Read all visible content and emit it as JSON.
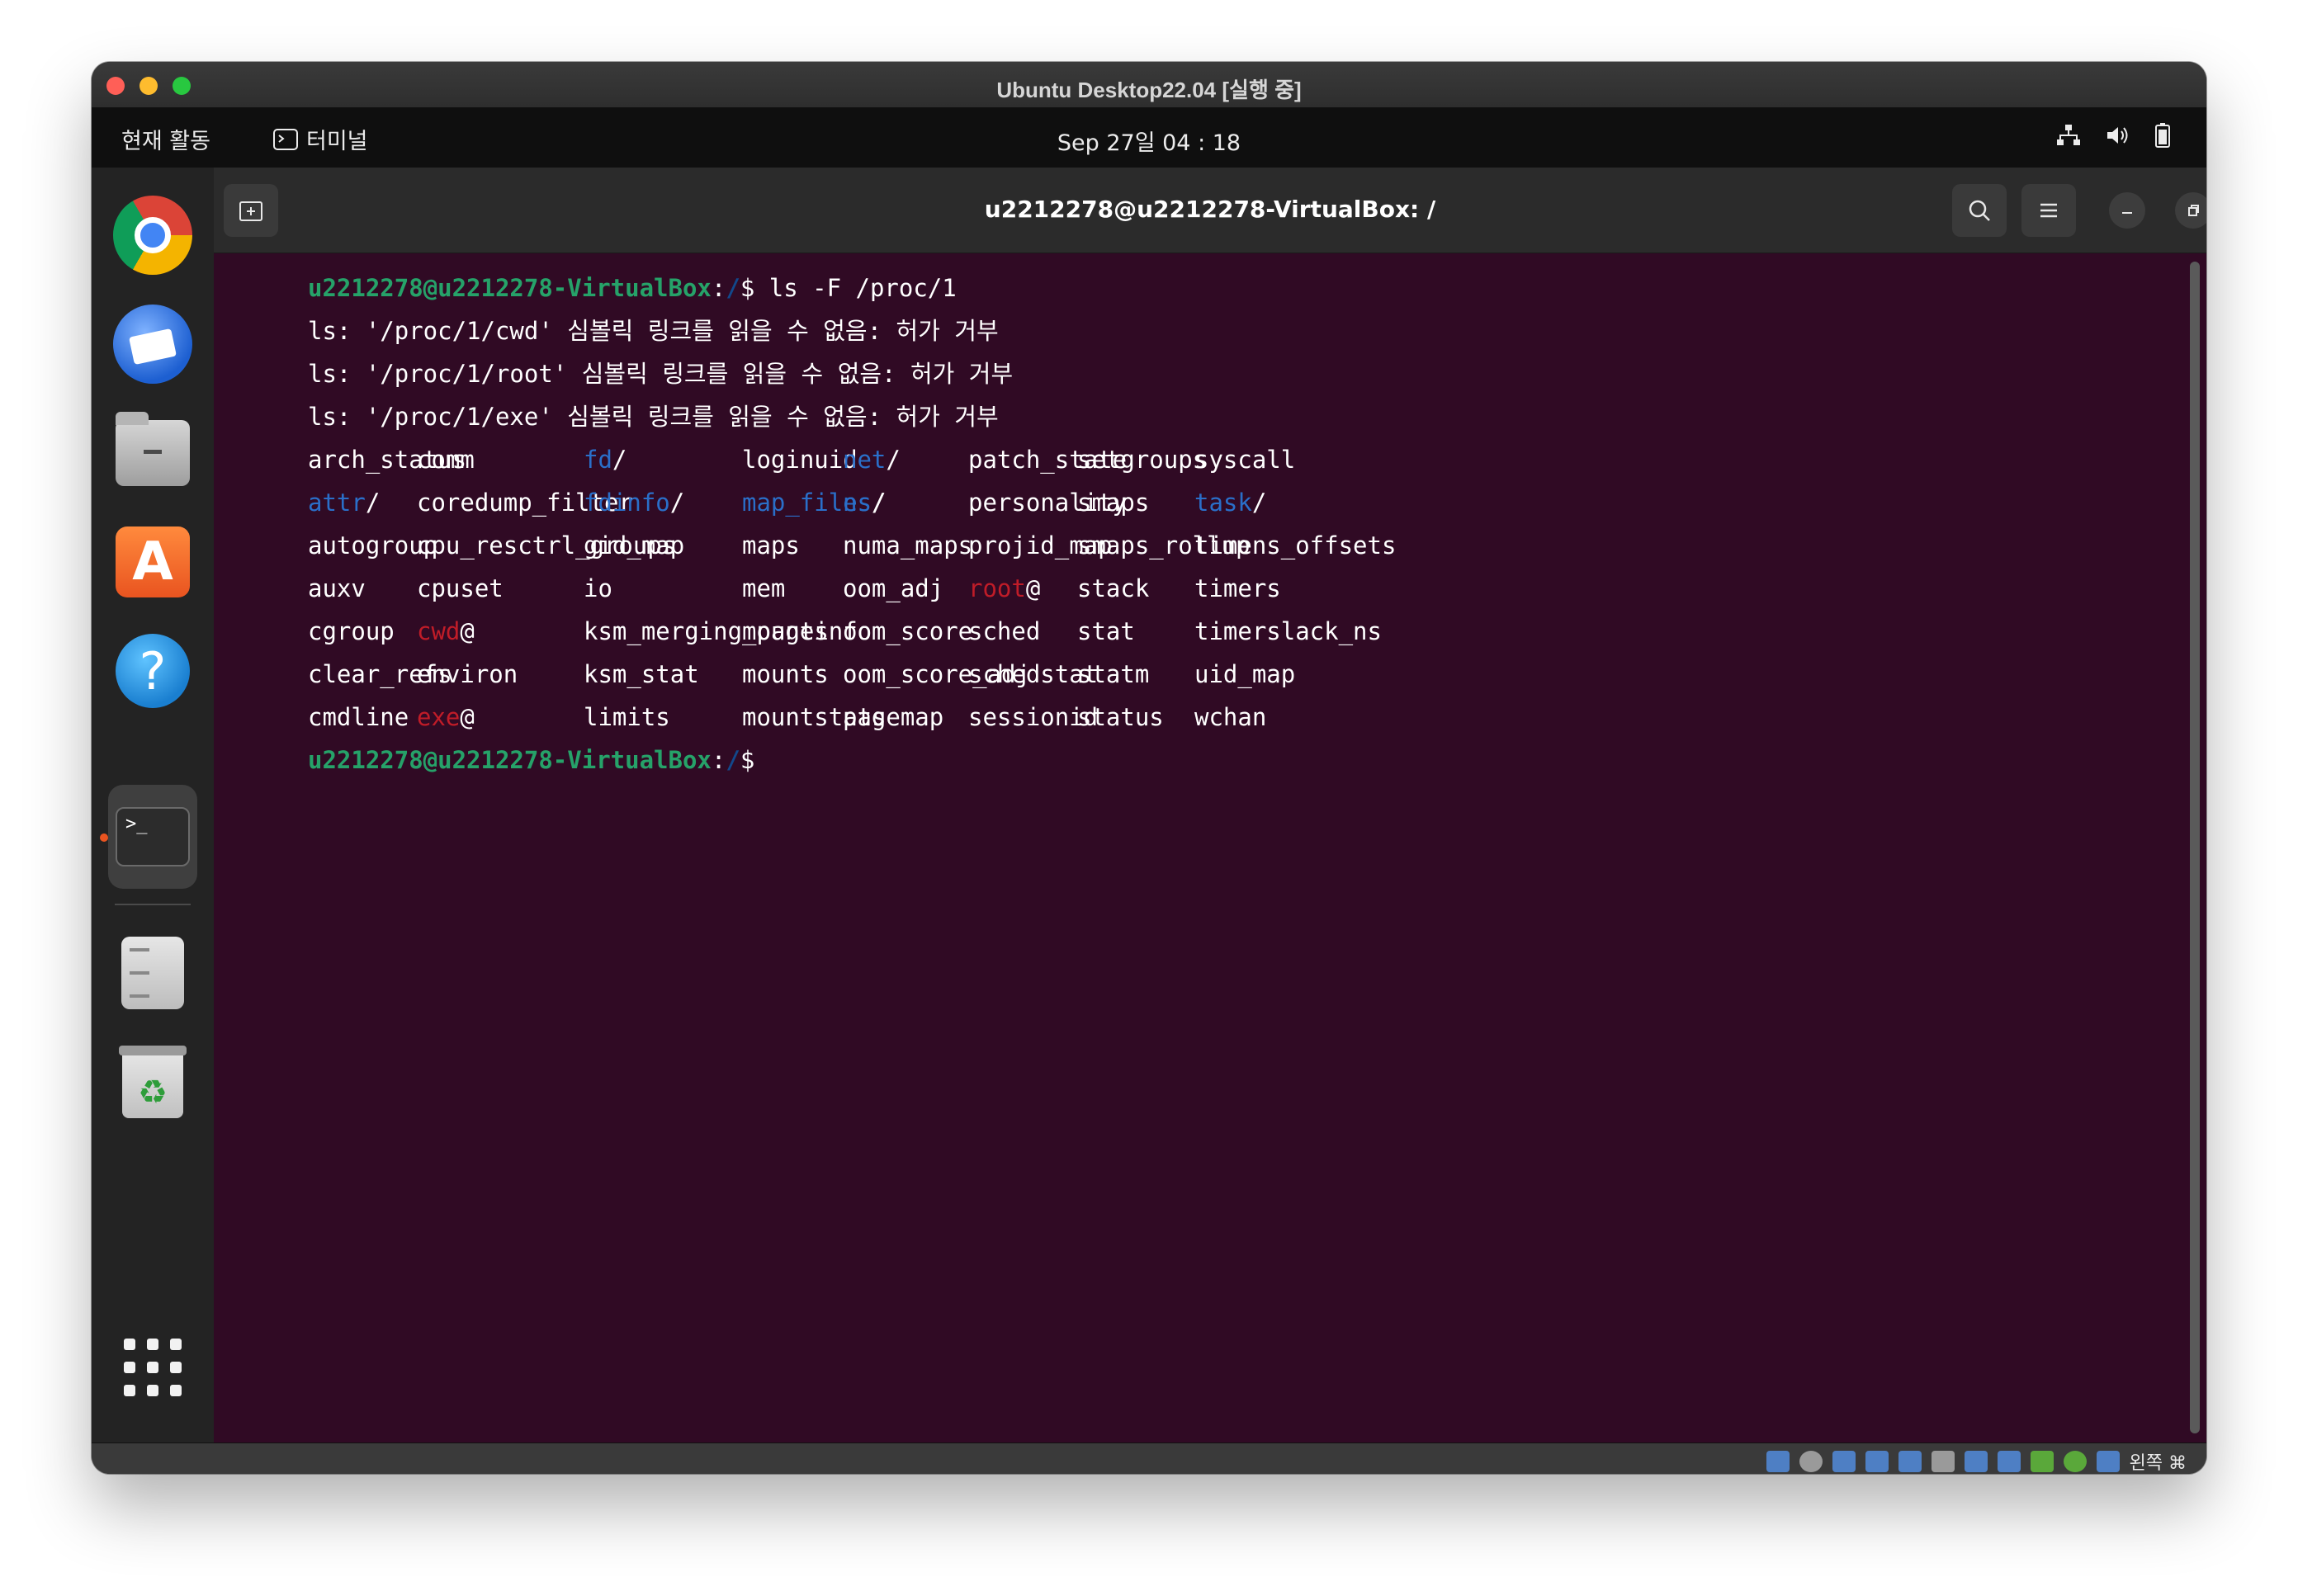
{
  "vbox": {
    "title": "Ubuntu Desktop22.04 [실행 중]",
    "status_host_key": "왼쪽 ⌘"
  },
  "topbar": {
    "activities": "현재 활동",
    "app_name": "터미널",
    "clock": "Sep 27일  04 : 18"
  },
  "dock": {
    "items": [
      "chrome-icon",
      "thunderbird-icon",
      "files-icon",
      "app-center-icon",
      "help-icon",
      "terminal-icon",
      "disk-icon",
      "trash-icon",
      "show-apps-icon"
    ]
  },
  "terminal": {
    "title": "u2212278@u2212278-VirtualBox: /",
    "prompt_user": "u2212278@u2212278-VirtualBox",
    "prompt_sep": ":",
    "prompt_path": "/",
    "prompt_dollar": "$",
    "command": " ls -F /proc/1",
    "errors": [
      "ls: '/proc/1/cwd' 심볼릭 링크를 읽을 수 없음: 허가 거부",
      "ls: '/proc/1/root' 심볼릭 링크를 읽을 수 없음: 허가 거부",
      "ls: '/proc/1/exe' 심볼릭 링크를 읽을 수 없음: 허가 거부"
    ],
    "listing": {
      "rows": [
        [
          {
            "n": "arch_status",
            "t": "f"
          },
          {
            "n": "comm",
            "t": "f"
          },
          {
            "n": "fd",
            "s": "/",
            "t": "d"
          },
          {
            "n": "loginuid",
            "t": "f"
          },
          {
            "n": "net",
            "s": "/",
            "t": "d"
          },
          {
            "n": "patch_state",
            "t": "f"
          },
          {
            "n": "setgroups",
            "t": "f"
          },
          {
            "n": "syscall",
            "t": "f"
          }
        ],
        [
          {
            "n": "attr",
            "s": "/",
            "t": "d"
          },
          {
            "n": "coredump_filter",
            "t": "f"
          },
          {
            "n": "fdinfo",
            "s": "/",
            "t": "d"
          },
          {
            "n": "map_files",
            "s": "/",
            "t": "d"
          },
          {
            "n": "ns",
            "s": "/",
            "t": "d"
          },
          {
            "n": "personality",
            "t": "f"
          },
          {
            "n": "smaps",
            "t": "f"
          },
          {
            "n": "task",
            "s": "/",
            "t": "d"
          }
        ],
        [
          {
            "n": "autogroup",
            "t": "f"
          },
          {
            "n": "cpu_resctrl_groups",
            "t": "f"
          },
          {
            "n": "gid_map",
            "t": "f"
          },
          {
            "n": "maps",
            "t": "f"
          },
          {
            "n": "numa_maps",
            "t": "f"
          },
          {
            "n": "projid_map",
            "t": "f"
          },
          {
            "n": "smaps_rollup",
            "t": "f"
          },
          {
            "n": "timens_offsets",
            "t": "f"
          }
        ],
        [
          {
            "n": "auxv",
            "t": "f"
          },
          {
            "n": "cpuset",
            "t": "f"
          },
          {
            "n": "io",
            "t": "f"
          },
          {
            "n": "mem",
            "t": "f"
          },
          {
            "n": "oom_adj",
            "t": "f"
          },
          {
            "n": "root",
            "s": "@",
            "t": "l"
          },
          {
            "n": "stack",
            "t": "f"
          },
          {
            "n": "timers",
            "t": "f"
          }
        ],
        [
          {
            "n": "cgroup",
            "t": "f"
          },
          {
            "n": "cwd",
            "s": "@",
            "t": "l"
          },
          {
            "n": "ksm_merging_pages",
            "t": "f"
          },
          {
            "n": "mountinfo",
            "t": "f"
          },
          {
            "n": "oom_score",
            "t": "f"
          },
          {
            "n": "sched",
            "t": "f"
          },
          {
            "n": "stat",
            "t": "f"
          },
          {
            "n": "timerslack_ns",
            "t": "f"
          }
        ],
        [
          {
            "n": "clear_refs",
            "t": "f"
          },
          {
            "n": "environ",
            "t": "f"
          },
          {
            "n": "ksm_stat",
            "t": "f"
          },
          {
            "n": "mounts",
            "t": "f"
          },
          {
            "n": "oom_score_adj",
            "t": "f"
          },
          {
            "n": "schedstat",
            "t": "f"
          },
          {
            "n": "statm",
            "t": "f"
          },
          {
            "n": "uid_map",
            "t": "f"
          }
        ],
        [
          {
            "n": "cmdline",
            "t": "f"
          },
          {
            "n": "exe",
            "s": "@",
            "t": "l"
          },
          {
            "n": "limits",
            "t": "f"
          },
          {
            "n": "mountstats",
            "t": "f"
          },
          {
            "n": "pagemap",
            "t": "f"
          },
          {
            "n": "sessionid",
            "t": "f"
          },
          {
            "n": "status",
            "t": "f"
          },
          {
            "n": "wchan",
            "t": "f"
          }
        ]
      ]
    },
    "colors": {
      "background": "#300a24",
      "prompt_user": "#26a269",
      "directory": "#2a6fc9",
      "broken_link": "#c01c28"
    }
  }
}
